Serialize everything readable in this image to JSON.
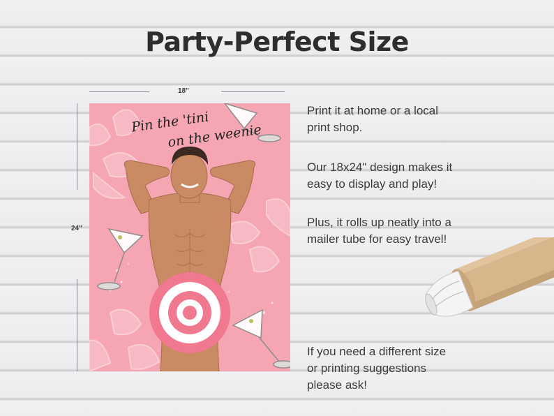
{
  "page": {
    "title": "Party-Perfect Size"
  },
  "dimensions": {
    "width_label": "18\"",
    "height_label": "24\""
  },
  "poster": {
    "title_line1": "Pin the 'tini",
    "title_line2": "on the weenie"
  },
  "description": {
    "paragraph1": [
      "Print it at home or a local",
      "print shop."
    ],
    "paragraph2": [
      "Our 18x24\" design makes it",
      "easy to display and play!"
    ],
    "paragraph3": [
      "Plus, it rolls up neatly into a",
      "mailer tube for easy travel!"
    ],
    "paragraph4": [
      "If you need a different size",
      "or printing suggestions",
      "please ask!"
    ]
  },
  "colors": {
    "poster_pink": "#f5a6b2",
    "target_pink": "#f0788f",
    "heading": "#2e2e30",
    "tube_kraft": "#d8b68c"
  },
  "icons": [
    "martini-glass-icon",
    "bikini-top-icon",
    "target-icon",
    "mailer-tube-icon"
  ]
}
